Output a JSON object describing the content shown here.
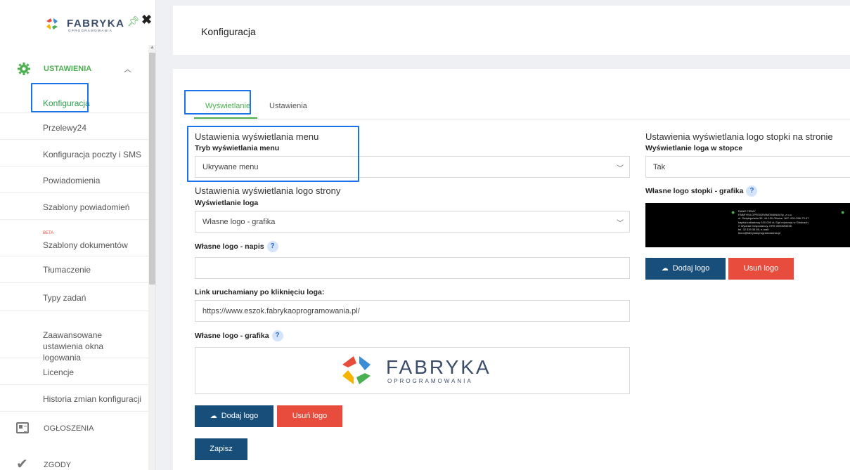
{
  "sidebar": {
    "logo_text": "FABRYKA",
    "logo_sub": "OPROGRAMOWANIA",
    "group_label": "USTAWIENIA",
    "items": [
      {
        "label": "Konfiguracja"
      },
      {
        "label": "Przelewy24"
      },
      {
        "label": "Konfiguracja poczty i SMS"
      },
      {
        "label": "Powiadomienia"
      },
      {
        "label": "Szablony powiadomień"
      },
      {
        "label": "Szablony dokumentów",
        "badge": "BETA"
      },
      {
        "label": "Tłumaczenie"
      },
      {
        "label": "Typy zadań"
      },
      {
        "label": "Zaawansowane ustawienia okna logowania"
      },
      {
        "label": "Licencje"
      },
      {
        "label": "Historia zmian konfiguracji"
      }
    ],
    "sections": [
      {
        "label": "OGŁOSZENIA"
      },
      {
        "label": "ZGODY"
      }
    ]
  },
  "header": {
    "title": "Konfiguracja"
  },
  "tabs": [
    {
      "label": "Wyświetlanie"
    },
    {
      "label": "Ustawienia"
    }
  ],
  "menu_settings": {
    "title": "Ustawienia wyświetlania menu",
    "mode_label": "Tryb wyświetlania menu",
    "mode_value": "Ukrywane menu"
  },
  "logo_settings": {
    "title": "Ustawienia wyświetlania logo strony",
    "display_label": "Wyświetlanie loga",
    "display_value": "Własne logo - grafika",
    "text_label": "Własne logo - napis",
    "text_value": "",
    "link_label": "Link uruchamiany po kliknięciu loga:",
    "link_value": "https://www.eszok.fabrykaoprogramowania.pl/",
    "graphic_label": "Własne logo - grafika",
    "preview_text": "FABRYKA",
    "preview_sub": "OPROGRAMOWANIA",
    "add_label": "Dodaj logo",
    "remove_label": "Usuń logo",
    "save_label": "Zapisz"
  },
  "footer_settings": {
    "title": "Ustawienia wyświetlania logo stopki na stronie",
    "display_label": "Wyświetlanie loga w stopce",
    "display_value": "Tak",
    "graphic_label": "Własne logo stopki - grafika",
    "footer_logo_text": "DANE FIRMY\nFABRYKA OPROGRAMOWANIA Sp. z o.o.\nul. Świętojańska 35, 44-100 Gliwice, NIP: 631-266-73-37\nkapitał zakładowy 100 000 zł, Sąd rejonowy w Gliwicach,\nX Wydział Gospodarczy, KRS 0000693456\ntel. 32 339 35 55, e-mail:\nbiuro@fabrykaoprogramowania.pl",
    "add_label": "Dodaj logo",
    "remove_label": "Usuń logo"
  },
  "help_glyph": "?",
  "colors": {
    "accent": "#4caf50",
    "primary": "#174e7a",
    "danger": "#e74c3c",
    "highlight": "#1a73e8"
  }
}
